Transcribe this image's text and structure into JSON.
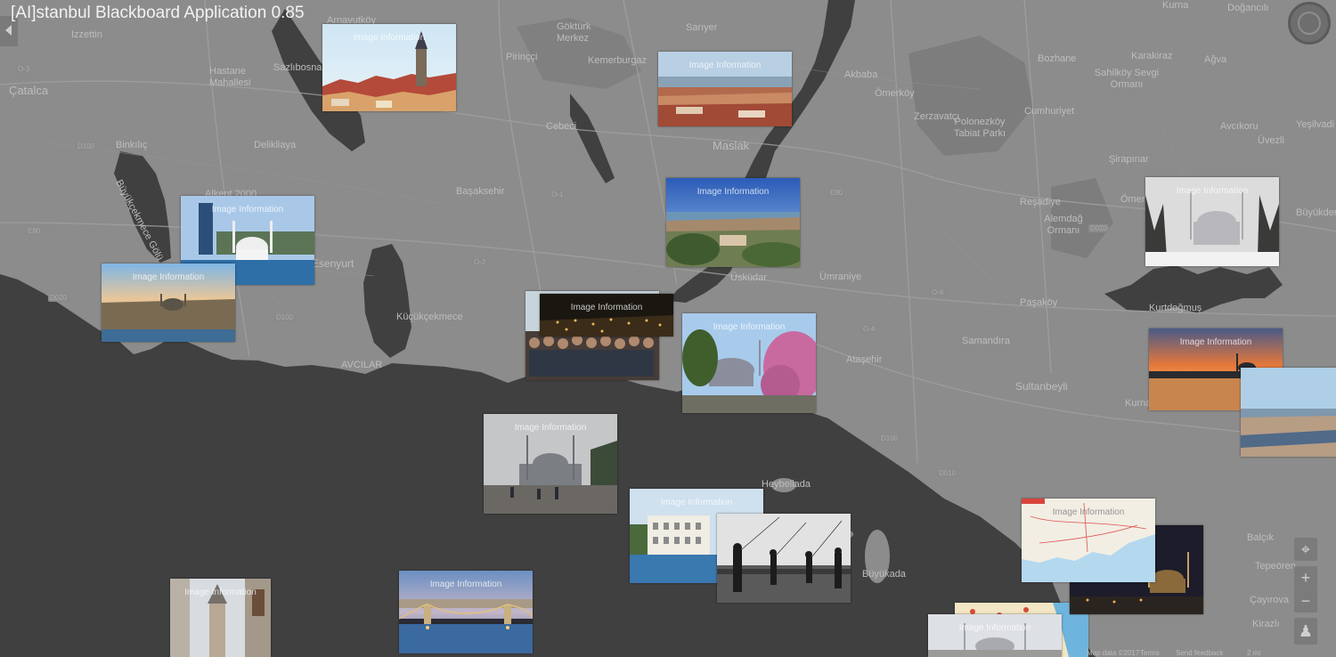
{
  "app": {
    "title": "[AI]stanbul Blackboard Application 0.85"
  },
  "photo_label": "Image Information",
  "photos": [
    {
      "id": "galata-tower"
    },
    {
      "id": "golden-horn-aerial"
    },
    {
      "id": "city-panorama"
    },
    {
      "id": "dolmabahce-mosque"
    },
    {
      "id": "skyline-sunset"
    },
    {
      "id": "crowd-night"
    },
    {
      "id": "night-city"
    },
    {
      "id": "blue-mosque-blossom"
    },
    {
      "id": "mosque-snow"
    },
    {
      "id": "galata-bridge-sunset"
    },
    {
      "id": "bosphorus-view"
    },
    {
      "id": "blue-mosque-rain"
    },
    {
      "id": "waterfront-building"
    },
    {
      "id": "fishermen-bw"
    },
    {
      "id": "istanbul-map"
    },
    {
      "id": "night-mosque"
    },
    {
      "id": "galata-street"
    },
    {
      "id": "chain-bridge"
    },
    {
      "id": "tourist-map"
    },
    {
      "id": "suleymaniye"
    }
  ],
  "places": [
    {
      "text": "Izzettin"
    },
    {
      "text": "Arnavutköy"
    },
    {
      "text": "Göktürk Merkez"
    },
    {
      "text": "Kemerburgaz"
    },
    {
      "text": "Pirinççi"
    },
    {
      "text": "Sarıyer"
    },
    {
      "text": "Cebeci"
    },
    {
      "text": "Maslak"
    },
    {
      "text": "Çatalca"
    },
    {
      "text": "Hastane Mahallesi"
    },
    {
      "text": "Sazlıbosna"
    },
    {
      "text": "Başaksehir"
    },
    {
      "text": "Binkılıç"
    },
    {
      "text": "Delikliaya"
    },
    {
      "text": "Büyükçekmece Gölü"
    },
    {
      "text": "Alkent 2000"
    },
    {
      "text": "Esenyurt"
    },
    {
      "text": "Küçükçekmece"
    },
    {
      "text": "AVCILAR"
    },
    {
      "text": "Üsküdar"
    },
    {
      "text": "Ümraniye"
    },
    {
      "text": "Ataşehir"
    },
    {
      "text": "Samandıra"
    },
    {
      "text": "Sultanbeyli"
    },
    {
      "text": "Paşaköy"
    },
    {
      "text": "Reşadiye"
    },
    {
      "text": "Polonezköy Tabiat Parkı"
    },
    {
      "text": "Akbaba"
    },
    {
      "text": "Ömerköy"
    },
    {
      "text": "Zerzavatçı"
    },
    {
      "text": "Cumhuriyet"
    },
    {
      "text": "Bozhane"
    },
    {
      "text": "Alemdağ Ormanı"
    },
    {
      "text": "Kurna"
    },
    {
      "text": "Doğancılı"
    },
    {
      "text": "Karakiraz"
    },
    {
      "text": "Ağva"
    },
    {
      "text": "Sahilköy Sevgi Ormanı"
    },
    {
      "text": "Avcıkoru"
    },
    {
      "text": "Yeşilvadi"
    },
    {
      "text": "Üvezli"
    },
    {
      "text": "Şirapınar"
    },
    {
      "text": "Ömerli"
    },
    {
      "text": "Büyükderе"
    },
    {
      "text": "Kurtdoğmuş"
    },
    {
      "text": "Kurna"
    },
    {
      "text": "Heybeliada"
    },
    {
      "text": "Büyükada"
    },
    {
      "text": "Balçık"
    },
    {
      "text": "Çayırova"
    },
    {
      "text": "Kirazlı"
    },
    {
      "text": "Tepeören"
    }
  ],
  "roads": [
    {
      "text": "O-3"
    },
    {
      "text": "D100"
    },
    {
      "text": "O-1"
    },
    {
      "text": "D020"
    },
    {
      "text": "E80"
    },
    {
      "text": "O-2"
    },
    {
      "text": "D100"
    },
    {
      "text": "O-4"
    },
    {
      "text": "D010"
    },
    {
      "text": "E80"
    },
    {
      "text": "D020"
    },
    {
      "text": "O-6"
    },
    {
      "text": "D100"
    }
  ],
  "map_controls": {
    "locate": "⌖",
    "zoom_in": "+",
    "zoom_out": "−",
    "pegman": "♟"
  },
  "footer": {
    "terms": "Terms",
    "report": "Send feedback",
    "scale": "2 mi",
    "map_data": "Map data ©2017"
  }
}
